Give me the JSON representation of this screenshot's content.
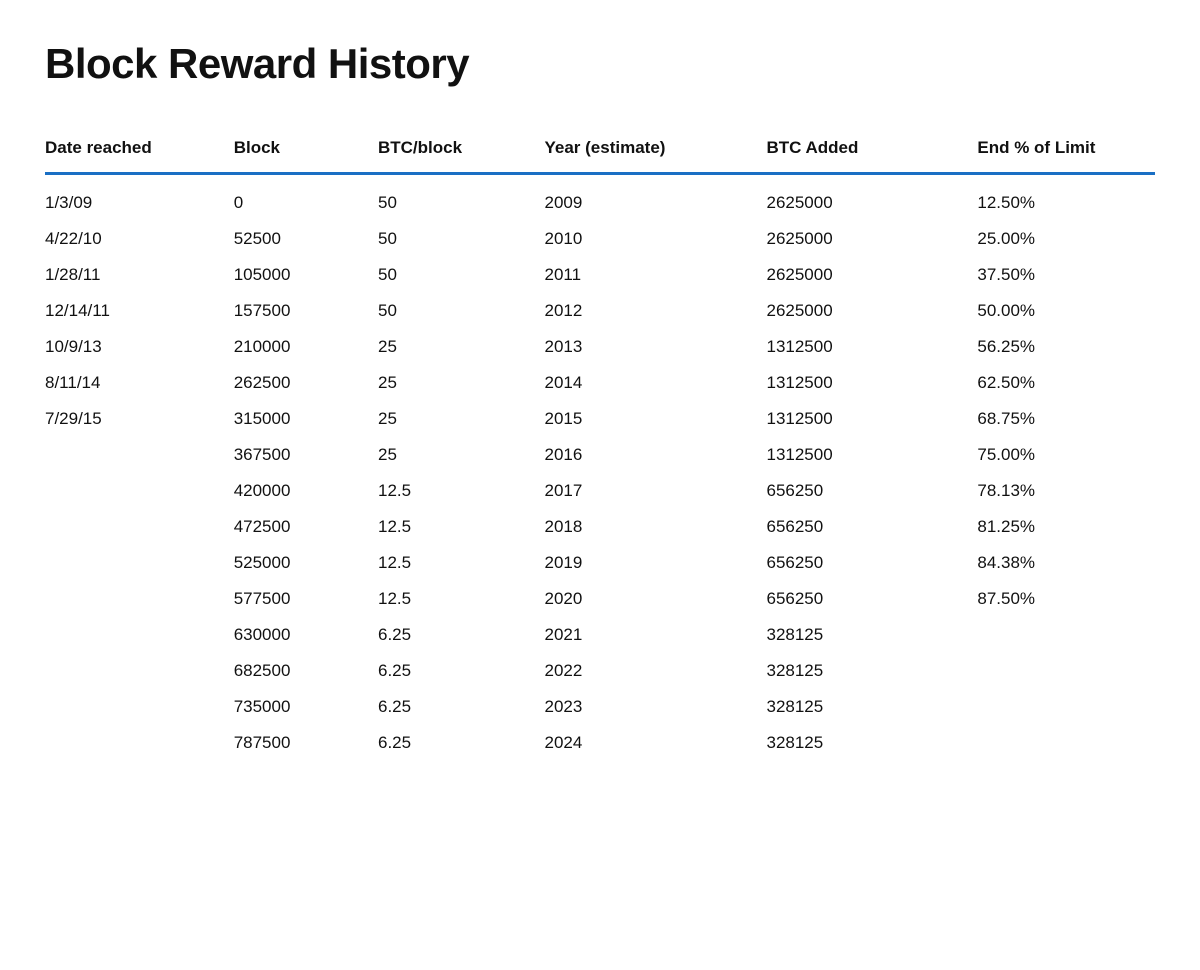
{
  "page": {
    "title": "Block Reward History"
  },
  "table": {
    "columns": [
      "Date reached",
      "Block",
      "BTC/block",
      "Year (estimate)",
      "BTC Added",
      "End % of Limit"
    ],
    "rows": [
      {
        "date": "1/3/09",
        "block": "0",
        "btc_block": "50",
        "year": "2009",
        "btc_added": "2625000",
        "end_pct": "12.50%"
      },
      {
        "date": "4/22/10",
        "block": "52500",
        "btc_block": "50",
        "year": "2010",
        "btc_added": "2625000",
        "end_pct": "25.00%"
      },
      {
        "date": "1/28/11",
        "block": "105000",
        "btc_block": "50",
        "year": "2011",
        "btc_added": "2625000",
        "end_pct": "37.50%"
      },
      {
        "date": "12/14/11",
        "block": "157500",
        "btc_block": "50",
        "year": "2012",
        "btc_added": "2625000",
        "end_pct": "50.00%"
      },
      {
        "date": "10/9/13",
        "block": "210000",
        "btc_block": "25",
        "year": "2013",
        "btc_added": "1312500",
        "end_pct": "56.25%"
      },
      {
        "date": "8/11/14",
        "block": "262500",
        "btc_block": "25",
        "year": "2014",
        "btc_added": "1312500",
        "end_pct": "62.50%"
      },
      {
        "date": "7/29/15",
        "block": "315000",
        "btc_block": "25",
        "year": "2015",
        "btc_added": "1312500",
        "end_pct": "68.75%"
      },
      {
        "date": "",
        "block": "367500",
        "btc_block": "25",
        "year": "2016",
        "btc_added": "1312500",
        "end_pct": "75.00%"
      },
      {
        "date": "",
        "block": "420000",
        "btc_block": "12.5",
        "year": "2017",
        "btc_added": "656250",
        "end_pct": "78.13%"
      },
      {
        "date": "",
        "block": "472500",
        "btc_block": "12.5",
        "year": "2018",
        "btc_added": "656250",
        "end_pct": "81.25%"
      },
      {
        "date": "",
        "block": "525000",
        "btc_block": "12.5",
        "year": "2019",
        "btc_added": "656250",
        "end_pct": "84.38%"
      },
      {
        "date": "",
        "block": "577500",
        "btc_block": "12.5",
        "year": "2020",
        "btc_added": "656250",
        "end_pct": "87.50%"
      },
      {
        "date": "",
        "block": "630000",
        "btc_block": "6.25",
        "year": "2021",
        "btc_added": "328125",
        "end_pct": ""
      },
      {
        "date": "",
        "block": "682500",
        "btc_block": "6.25",
        "year": "2022",
        "btc_added": "328125",
        "end_pct": ""
      },
      {
        "date": "",
        "block": "735000",
        "btc_block": "6.25",
        "year": "2023",
        "btc_added": "328125",
        "end_pct": ""
      },
      {
        "date": "",
        "block": "787500",
        "btc_block": "6.25",
        "year": "2024",
        "btc_added": "328125",
        "end_pct": ""
      }
    ]
  }
}
